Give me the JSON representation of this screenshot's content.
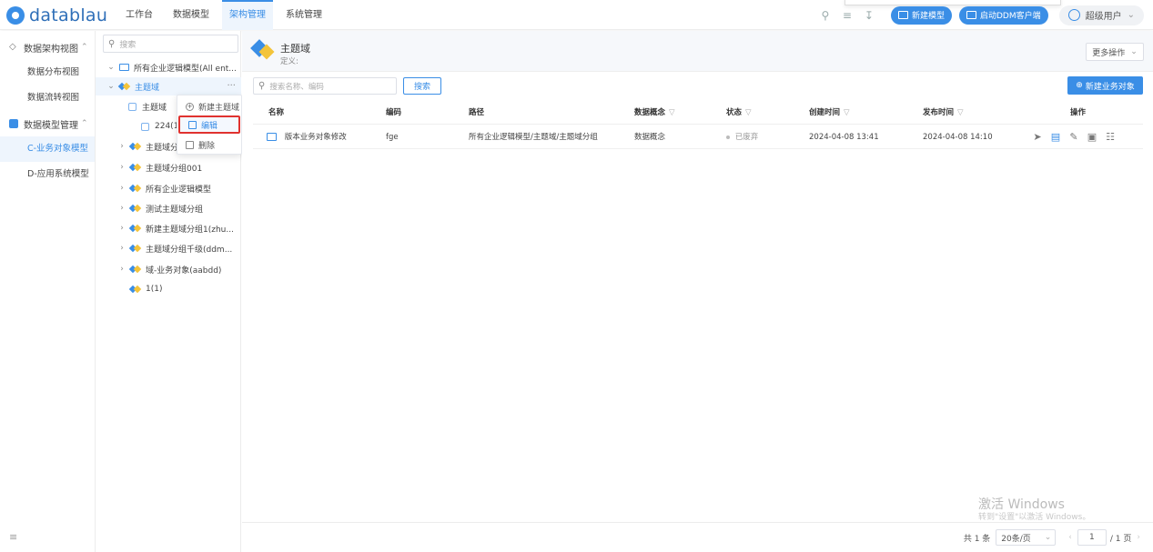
{
  "app": {
    "logo_text": "datablau"
  },
  "topnav": [
    {
      "label": "工作台"
    },
    {
      "label": "数据模型"
    },
    {
      "label": "架构管理",
      "active": true
    },
    {
      "label": "系统管理"
    }
  ],
  "topbar": {
    "new_model_label": "新建模型",
    "launch_ddm_label": "启动DDM客户端",
    "user_label": "超级用户"
  },
  "sidebar": {
    "groups": [
      {
        "label": "数据架构视图",
        "items": [
          "数据分布视图",
          "数据流转视图"
        ]
      },
      {
        "label": "数据模型管理",
        "items": [
          "C-业务对象模型",
          "D-应用系统模型"
        ]
      }
    ]
  },
  "tree": {
    "search_placeholder": "搜索",
    "root": "所有企业逻辑模型(All ent...",
    "selected": "主题域",
    "children": [
      "主题域",
      "224(11"
    ],
    "siblings_partial": "主题域分组",
    "nodes": [
      "主题域分组001",
      "所有企业逻辑模型",
      "测试主题域分组",
      "新建主题域分组1(zhu...",
      "主题域分组千级(ddm...",
      "域-业务对象(aabdd)",
      "1(1)"
    ]
  },
  "context_menu": {
    "items": [
      "新建主题域",
      "编辑",
      "删除"
    ]
  },
  "main": {
    "title": "主题域",
    "definition": "定义:",
    "more_ops": "更多操作",
    "search_placeholder": "搜索名称、编码",
    "search_button": "搜索",
    "new_button": "新建业务对象",
    "columns": [
      "名称",
      "编码",
      "路径",
      "数据概念",
      "状态",
      "创建时间",
      "发布时间",
      "操作"
    ],
    "rows": [
      {
        "name": "版本业务对象修改",
        "code": "fge",
        "path": "所有企业逻辑模型/主题域/主题域分组",
        "concept": "数据概念",
        "status": "已废弃",
        "created": "2024-04-08 13:41",
        "published": "2024-04-08 14:10"
      }
    ]
  },
  "pagination": {
    "total": "共 1 条",
    "page_size": "20条/页",
    "current": "1",
    "pages": "/ 1 页"
  },
  "watermark": {
    "line1": "激活 Windows",
    "line2": "转到\"设置\"以激活 Windows。"
  }
}
